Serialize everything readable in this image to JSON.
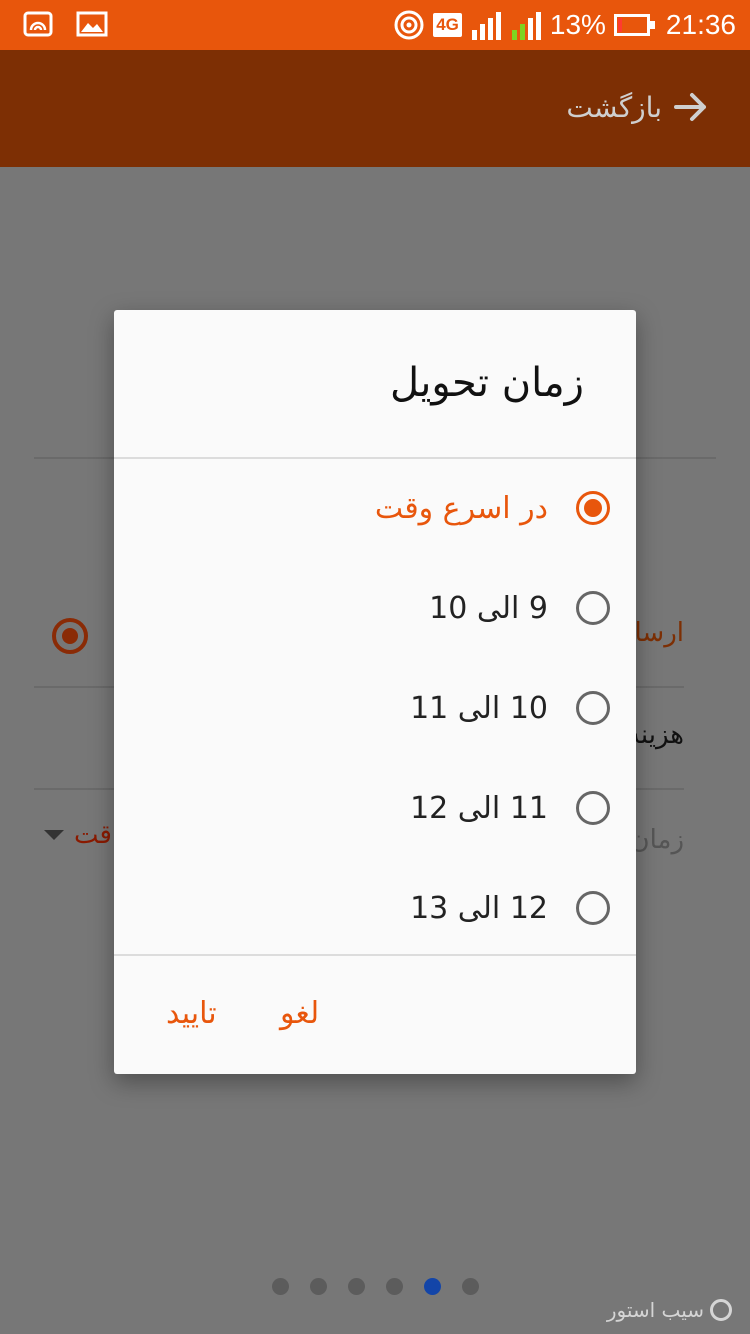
{
  "status_bar": {
    "battery_percent": "13%",
    "battery_level": 0.13,
    "time": "21:36",
    "network": "4G",
    "sim1": "1",
    "sim2": "2",
    "icons": [
      "cast-icon",
      "image-icon",
      "hotspot-icon",
      "signal-icon",
      "signal-icon",
      "battery-icon"
    ]
  },
  "app_bar": {
    "back_label": "بازگشت"
  },
  "background": {
    "row_send": "ارسال",
    "row_cost": "هزینه",
    "row_time": "زمان",
    "row_time_value": "قت"
  },
  "dialog": {
    "title": "زمان تحویل",
    "options": [
      {
        "label": "در اسرع وقت",
        "selected": true
      },
      {
        "label": "9 الی 10",
        "selected": false
      },
      {
        "label": "10 الی 11",
        "selected": false
      },
      {
        "label": "11 الی 12",
        "selected": false
      },
      {
        "label": "12 الی 13",
        "selected": false
      }
    ],
    "cancel_label": "لغو",
    "confirm_label": "تایید"
  },
  "pager": {
    "count": 6,
    "active_index": 4
  },
  "watermark": "سیب استور",
  "colors": {
    "accent": "#e8560c",
    "app_bar": "#7d2f04",
    "overlay": "#777777",
    "active_dot": "#1345a8"
  }
}
